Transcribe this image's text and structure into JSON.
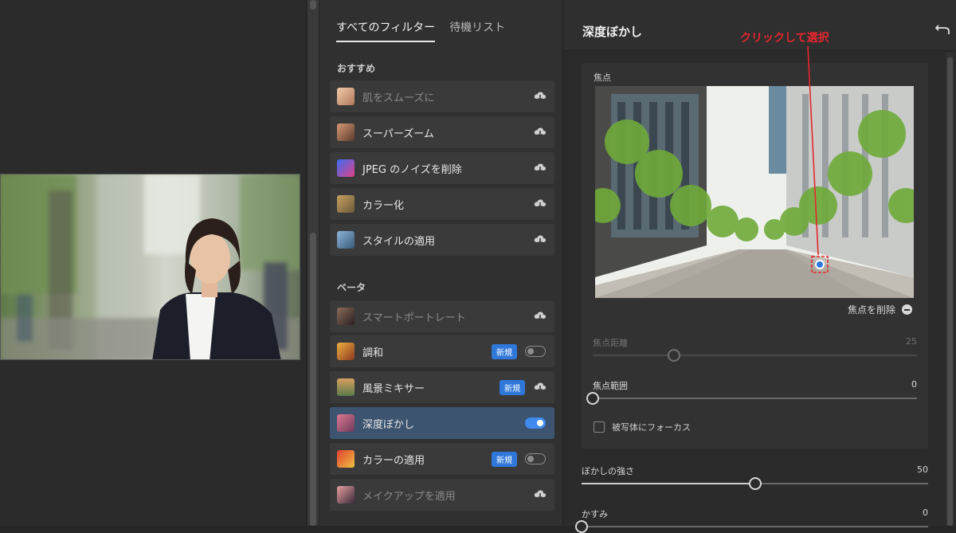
{
  "filter_panel": {
    "tabs": [
      {
        "label": "すべてのフィルター",
        "active": true
      },
      {
        "label": "待機リスト",
        "active": false
      }
    ],
    "sections": {
      "recommended": "おすすめ",
      "beta": "ベータ"
    },
    "recommended_items": [
      {
        "label": "肌をスムーズに",
        "dimmed": true,
        "control": "cloud-download-icon"
      },
      {
        "label": "スーパーズーム",
        "dimmed": false,
        "control": "cloud-download-icon"
      },
      {
        "label": "JPEG のノイズを削除",
        "dimmed": false,
        "control": "cloud-download-icon"
      },
      {
        "label": "カラー化",
        "dimmed": false,
        "control": "cloud-download-icon"
      },
      {
        "label": "スタイルの適用",
        "dimmed": false,
        "control": "cloud-download-icon"
      }
    ],
    "beta_items": [
      {
        "label": "スマートポートレート",
        "dimmed": true,
        "control": "cloud-download-icon",
        "badge": ""
      },
      {
        "label": "調和",
        "dimmed": false,
        "control": "toggle-off",
        "badge": "新規"
      },
      {
        "label": "風景ミキサー",
        "dimmed": false,
        "control": "cloud-download-icon",
        "badge": "新規"
      },
      {
        "label": "深度ぼかし",
        "dimmed": false,
        "control": "toggle-on",
        "badge": "",
        "selected": true
      },
      {
        "label": "カラーの適用",
        "dimmed": false,
        "control": "toggle-off",
        "badge": "新規"
      },
      {
        "label": "メイクアップを適用",
        "dimmed": true,
        "control": "cloud-download-icon",
        "badge": ""
      }
    ]
  },
  "settings_panel": {
    "title": "深度ぼかし",
    "annotation": "クリックして選択",
    "focus_label": "焦点",
    "remove_focus": "焦点を削除",
    "sliders": {
      "focal_distance": {
        "label": "焦点距離",
        "value": "25",
        "fraction": 0.25,
        "disabled": true
      },
      "focal_range": {
        "label": "焦点範囲",
        "value": "0",
        "fraction": 0.0,
        "disabled": false
      },
      "blur_strength": {
        "label": "ぼかしの強さ",
        "value": "50",
        "fraction": 0.5,
        "disabled": false
      },
      "haze": {
        "label": "かすみ",
        "value": "0",
        "fraction": 0.0,
        "disabled": false
      }
    },
    "checkbox": {
      "label": "被写体にフォーカス",
      "checked": false
    }
  },
  "colors": {
    "accent_blue": "#3e8bef",
    "badge_blue": "#2f78da",
    "annotation_red": "#e5262d",
    "selected_row": "#3d5470"
  }
}
